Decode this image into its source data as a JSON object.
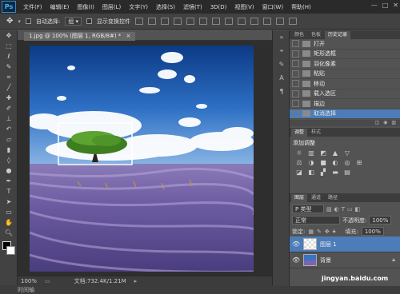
{
  "app": {
    "logo": "Ps"
  },
  "menu": [
    "文件(F)",
    "编辑(E)",
    "图像(I)",
    "图层(L)",
    "文字(Y)",
    "选择(S)",
    "滤镜(T)",
    "3D(D)",
    "视图(V)",
    "窗口(W)",
    "帮助(H)"
  ],
  "window_controls": [
    "—",
    "□",
    "✕"
  ],
  "options": {
    "auto_select_label": "自动选择:",
    "auto_select_value": "组",
    "transform_label": "显示变换控件"
  },
  "document": {
    "tab_label": "1.jpg @ 100% (图层 1, RGB/8#) *",
    "close": "×"
  },
  "status": {
    "zoom": "100%",
    "doc_info": "文档:732.4K/1.21M"
  },
  "bottom": {
    "label": "时间轴"
  },
  "history_panel": {
    "tabs": [
      "颜色",
      "色板",
      "历史记录"
    ],
    "rows": [
      "打开",
      "矩形选框",
      "羽化像素",
      "粘贴",
      "移动",
      "载入选区",
      "描边",
      "取消选择"
    ]
  },
  "adjust_panel": {
    "tabs": [
      "调整",
      "样式"
    ],
    "title": "添加调整",
    "icons": [
      "☼",
      "▥",
      "◩",
      "▲",
      "▽",
      "",
      "",
      "",
      "⚖",
      "◑",
      "■",
      "◐",
      "◎",
      "⊞",
      "",
      "",
      "◪",
      "◧",
      "▞",
      "▬",
      "▤",
      "",
      "",
      ""
    ]
  },
  "layers_panel": {
    "tabs": [
      "图层",
      "通道",
      "路径"
    ],
    "filter": "P 类型",
    "blend": "正常",
    "opacity_label": "不透明度:",
    "opacity": "100%",
    "lock_label": "锁定:",
    "fill_label": "填充:",
    "fill": "100%",
    "layers": [
      {
        "name": "图层 1",
        "selected": true
      },
      {
        "name": "背景",
        "selected": false
      }
    ]
  },
  "watermark": "jingyan.baidu.com"
}
